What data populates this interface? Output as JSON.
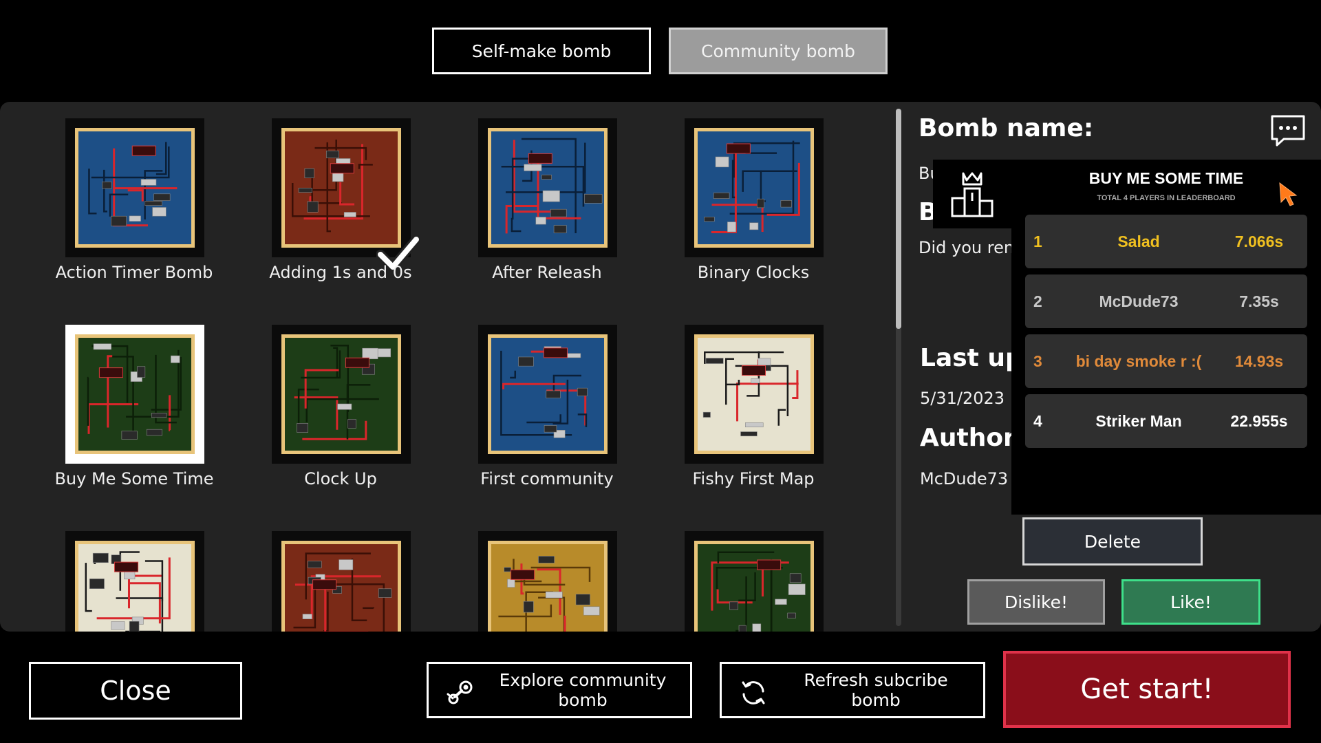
{
  "tabs": {
    "self_make": "Self-make bomb",
    "community": "Community bomb"
  },
  "bombs": [
    {
      "name": "Action Timer Bomb",
      "board": "blue"
    },
    {
      "name": "Adding 1s and 0s",
      "board": "brown",
      "completed": true
    },
    {
      "name": "After Releash",
      "board": "blue"
    },
    {
      "name": "Binary Clocks",
      "board": "blue"
    },
    {
      "name": "Buy Me Some Time",
      "board": "green",
      "selected": true
    },
    {
      "name": "Clock Up",
      "board": "green"
    },
    {
      "name": "First community",
      "board": "blue"
    },
    {
      "name": "Fishy First Map",
      "board": "cream"
    },
    {
      "name": "",
      "board": "cream"
    },
    {
      "name": "",
      "board": "brown"
    },
    {
      "name": "",
      "board": "gold"
    },
    {
      "name": "",
      "board": "green"
    }
  ],
  "details": {
    "bomb_name_label": "Bomb name:",
    "bomb_name_value": "Bu",
    "description_label": "B",
    "description_value": "Did you ren",
    "last_updated_label": "Last up",
    "last_updated_value": "5/31/2023",
    "author_label": "Author:",
    "author_value": "McDude73"
  },
  "leaderboard": {
    "title": "BUY ME SOME TIME",
    "subtitle": "TOTAL 4 PLAYERS IN LEADERBOARD",
    "entries": [
      {
        "rank": "1",
        "name": "Salad",
        "time": "7.066s",
        "color": "#f0c020"
      },
      {
        "rank": "2",
        "name": "McDude73",
        "time": "7.35s",
        "color": "#c9c9c9"
      },
      {
        "rank": "3",
        "name": "bi day smoke r :(",
        "time": "14.93s",
        "color": "#e08a3a"
      },
      {
        "rank": "4",
        "name": "Striker Man",
        "time": "22.955s",
        "color": "#ffffff"
      }
    ]
  },
  "actions": {
    "delete": "Delete",
    "dislike": "Dislike!",
    "like": "Like!",
    "close": "Close",
    "explore": "Explore community bomb",
    "refresh": "Refresh subcribe bomb",
    "start": "Get start!"
  },
  "icons": {
    "chat": "chat-bubble-icon",
    "podium": "leaderboard-podium-icon",
    "cursor": "pointer-cursor-icon",
    "explore": "steam-icon",
    "refresh": "refresh-icon",
    "check": "checkmark-icon"
  },
  "colors": {
    "board_blue": "#1d4f86",
    "board_brown": "#7a2a17",
    "board_green": "#1d3d17",
    "board_cream": "#e6e2cf",
    "board_gold": "#b88b2a",
    "board_frame": "#e8c47a",
    "start_button": "#8a0e1a",
    "like_button": "#2f7a52",
    "gold_rank": "#f0c020",
    "bronze_rank": "#e08a3a",
    "cursor_orange": "#ff7a1a"
  }
}
